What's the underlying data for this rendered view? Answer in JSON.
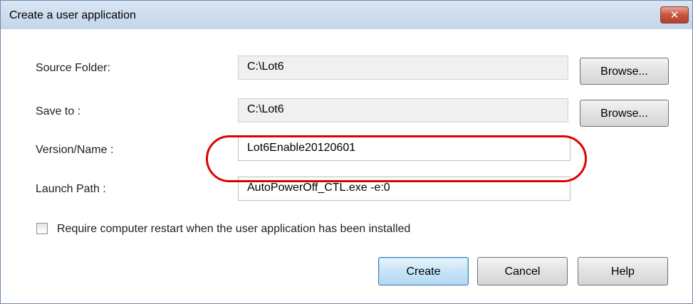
{
  "window": {
    "title": "Create a user application",
    "close_glyph": "✕"
  },
  "form": {
    "source_folder": {
      "label": "Source Folder:",
      "value": "C:\\Lot6",
      "browse_label": "Browse..."
    },
    "save_to": {
      "label": "Save to :",
      "value": "C:\\Lot6",
      "browse_label": "Browse..."
    },
    "version_name": {
      "label": "Version/Name :",
      "value": "Lot6Enable20120601"
    },
    "launch_path": {
      "label": "Launch Path :",
      "value": "AutoPowerOff_CTL.exe -e:0"
    },
    "restart_checkbox": {
      "label": "Require computer restart when the user application has been installed",
      "checked": false
    }
  },
  "buttons": {
    "create": "Create",
    "cancel": "Cancel",
    "help": "Help"
  },
  "colors": {
    "highlight": "#e00000",
    "title_bar": "#c3d5ea",
    "close_button": "#c7533f"
  }
}
